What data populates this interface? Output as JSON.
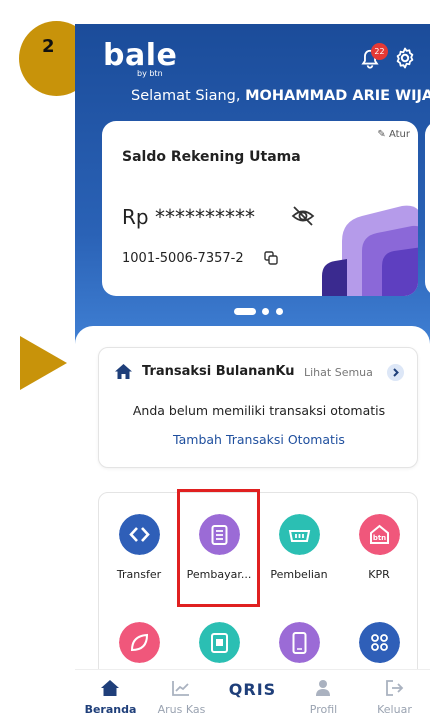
{
  "annotation": {
    "step": "2"
  },
  "header": {
    "logo_text": "bale",
    "logo_sub": "by btn",
    "notification_count": "22",
    "greeting": "Selamat Siang,",
    "user_name": "MOHAMMAD ARIE WIJAKS"
  },
  "card": {
    "edit_label": "Atur",
    "title": "Saldo Rekening Utama",
    "balance": "Rp **********",
    "account_number": "1001-5006-7357-2"
  },
  "transaksi": {
    "title": "Transaksi BulananKu",
    "see_all": "Lihat Semua",
    "empty_text": "Anda belum memiliki transaksi otomatis",
    "add_link": "Tambah Transaksi Otomatis"
  },
  "menu": {
    "items": [
      {
        "label": "Transfer",
        "color": "#2F5FB8",
        "icon": "transfer-icon"
      },
      {
        "label": "Pembayar...",
        "color": "#9B6BD6",
        "icon": "receipt-icon"
      },
      {
        "label": "Pembelian",
        "color": "#2BBFB3",
        "icon": "basket-icon"
      },
      {
        "label": "KPR",
        "color": "#F0577B",
        "icon": "house-icon"
      }
    ],
    "row2": [
      {
        "color": "#F0577B",
        "icon": "leaf-icon"
      },
      {
        "color": "#2BBFB3",
        "icon": "card-icon"
      },
      {
        "color": "#9B6BD6",
        "icon": "phone-icon"
      },
      {
        "color": "#2F5FB8",
        "icon": "grid-icon"
      }
    ]
  },
  "bottom_nav": {
    "items": [
      {
        "label": "Beranda",
        "icon": "home-icon",
        "active": true
      },
      {
        "label": "Arus Kas",
        "icon": "chart-icon",
        "active": false
      },
      {
        "label": "QRIS",
        "icon": "qris-icon",
        "active": false
      },
      {
        "label": "Profil",
        "icon": "user-icon",
        "active": false
      },
      {
        "label": "Keluar",
        "icon": "logout-icon",
        "active": false
      }
    ]
  }
}
